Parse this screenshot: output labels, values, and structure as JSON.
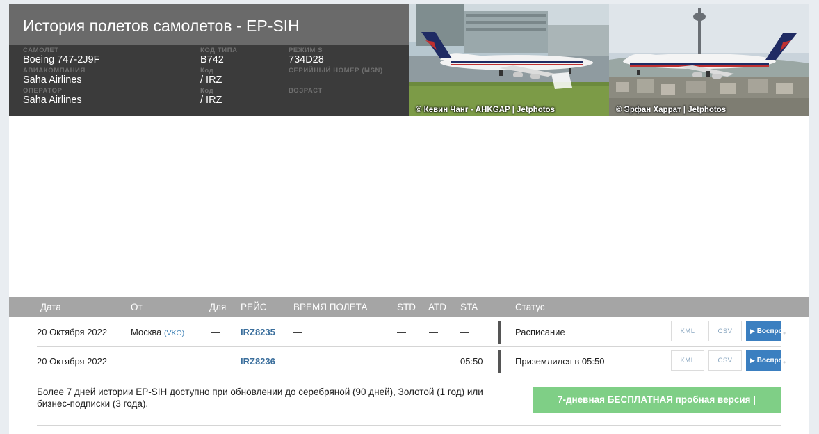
{
  "header": {
    "title": "История полетов самолетов - EP-SIH",
    "fields": {
      "aircraft_label": "САМОЛЕТ",
      "aircraft_value": "Boeing 747-2J9F",
      "type_code_label": "КОД ТИПА",
      "type_code_value": "B742",
      "mode_s_label": "РЕЖИМ S",
      "mode_s_value": "734D28",
      "airline_label": "АВИАКОМПАНИЯ",
      "airline_value": "Saha Airlines",
      "airline_code_label": "Код",
      "airline_code_value": "/ IRZ",
      "msn_label": "СЕРИЙНЫЙ НОМЕР (MSN)",
      "operator_label": "ОПЕРАТОР",
      "operator_value": "Saha Airlines",
      "operator_code_label": "Код",
      "operator_code_value": "/ IRZ",
      "age_label": "ВОЗРАСТ"
    }
  },
  "photos": [
    {
      "credit": "© Кевин Чанг - AHKGAP | Jetphotos"
    },
    {
      "credit": "© Эрфан Харрат | Jetphotos"
    }
  ],
  "colors": {
    "header_bg": "#3b3b3b",
    "title_bar_bg": "#6a6a6a",
    "table_header_bg": "#a5a5a5",
    "flight_link": "#3a6e9c",
    "play_button": "#3b7fc0",
    "trial_button": "#7fcf86"
  },
  "table": {
    "headers": {
      "date": "Дата",
      "from": "От",
      "to": "Для",
      "flight": "РЕЙС",
      "flight_time": "ВРЕМЯ ПОЛЕТА",
      "std": "STD",
      "atd": "ATD",
      "sta": "STA",
      "status": "Статус"
    },
    "rows": [
      {
        "date": "20 Октября 2022",
        "from": "Москва",
        "from_code": "(VKO)",
        "to": "—",
        "flight": "IRZ8235",
        "flight_time": "—",
        "std": "—",
        "atd": "—",
        "sta": "—",
        "status": "Расписание",
        "kml": "KML",
        "csv": "CSV",
        "play": "Воспроизвести"
      },
      {
        "date": "20 Октября 2022",
        "from": "—",
        "from_code": "",
        "to": "—",
        "flight": "IRZ8236",
        "flight_time": "—",
        "std": "—",
        "atd": "—",
        "sta": "05:50",
        "status": "Приземлился в 05:50",
        "kml": "KML",
        "csv": "CSV",
        "play": "Воспроизвести"
      }
    ]
  },
  "promo": {
    "text": "Более 7 дней истории EP-SIH доступно при обновлении до серебряной (90 дней), Золотой (1 год) или бизнес-подписки (3 года).",
    "button": "7-дневная БЕСПЛАТНАЯ пробная версия |"
  },
  "icons": {
    "play": "play-icon"
  }
}
